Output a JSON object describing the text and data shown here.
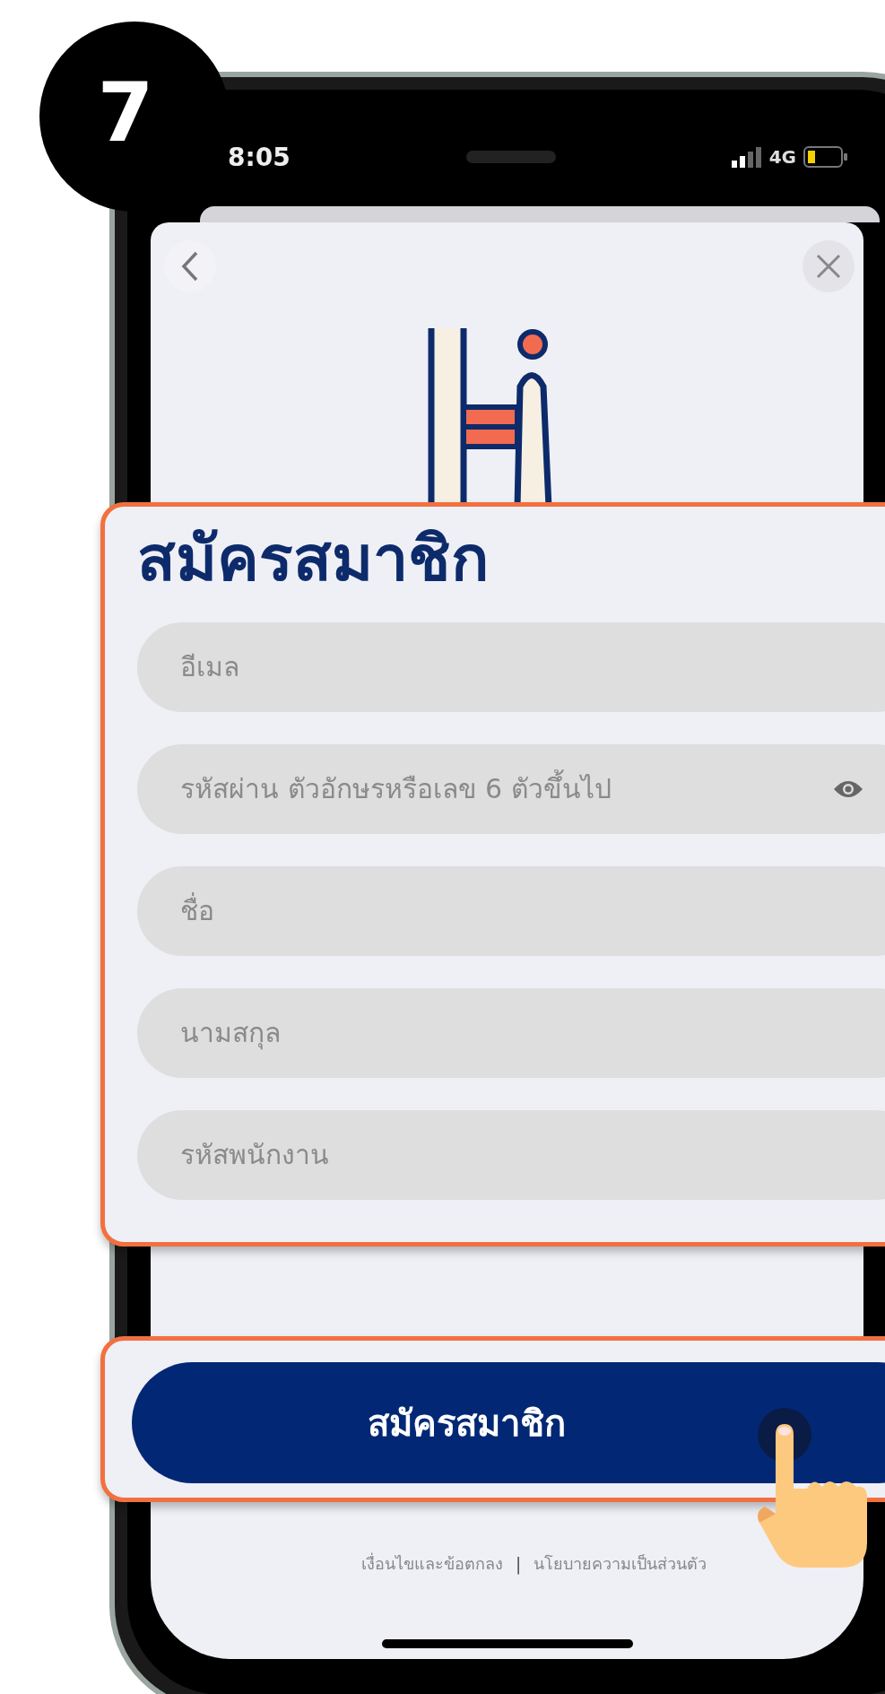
{
  "step_badge": "7",
  "status_bar": {
    "time": "8:05",
    "network": "4G"
  },
  "title": "สมัครสมาชิก",
  "fields": [
    {
      "kind": "text",
      "placeholder": "อีเมล"
    },
    {
      "kind": "password",
      "placeholder": "รหัสผ่าน ตัวอักษรหรือเลข 6 ตัวขึ้นไป"
    },
    {
      "kind": "text",
      "placeholder": "ชื่อ"
    },
    {
      "kind": "text",
      "placeholder": "นามสกุล"
    },
    {
      "kind": "text",
      "placeholder": "รหัสพนักงาน"
    }
  ],
  "submit_button": "สมัครสมาชิก",
  "footer_links": [
    "เงื่อนไขและข้อตกลง",
    "นโยบายความเป็นส่วนตัว"
  ],
  "footer_separator": "|"
}
